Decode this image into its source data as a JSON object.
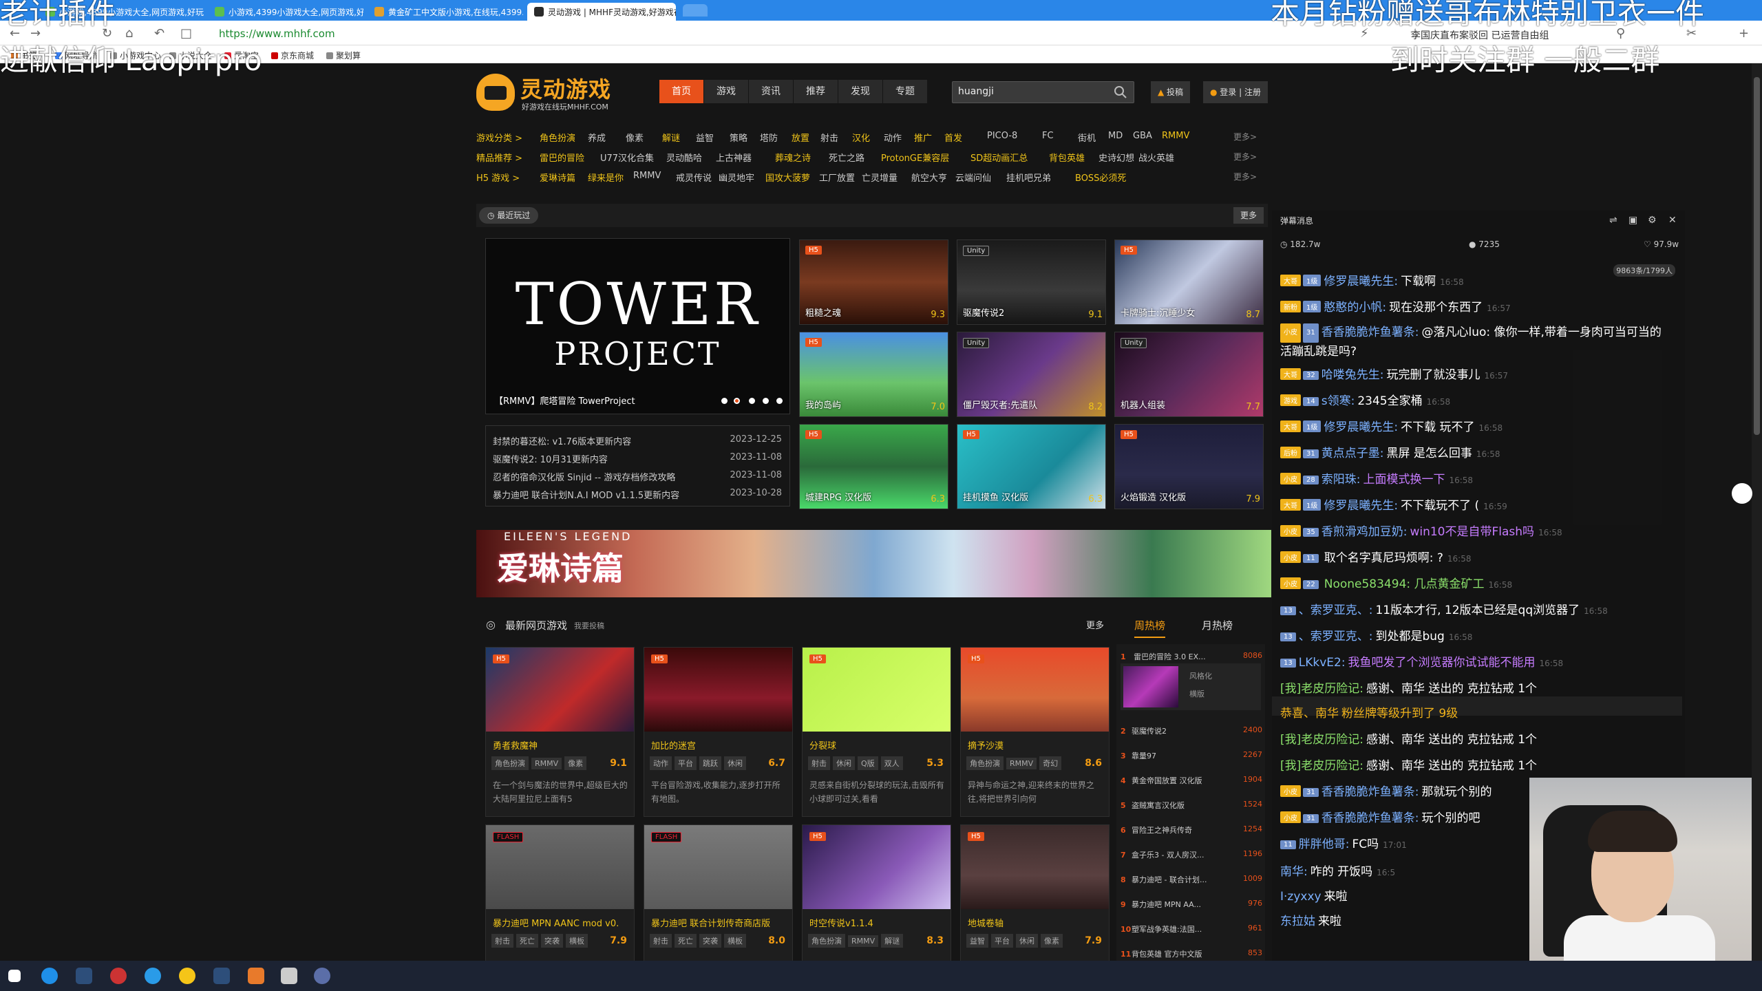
{
  "browser": {
    "tabs": [
      {
        "title": "小游戏,4399小游戏大全,网页游戏,好玩的..."
      },
      {
        "title": "小游戏,4399小游戏大全,网页游戏,好玩的..."
      },
      {
        "title": "黄金矿工中文版小游戏,在线玩,4399..."
      },
      {
        "title": "灵动游戏 | MHHF灵动游戏,好游戏在..."
      }
    ],
    "url": "https://www.mhhf.com",
    "bookmarks": [
      "书签",
      "网址导航",
      "小游戏中心",
      "小说大全",
      "爱淘宝",
      "京东商城",
      "聚划算"
    ],
    "promo_text": "李国庆直布案驳回 已运营自由组"
  },
  "site": {
    "logo_name": "灵动游戏",
    "logo_sub": "好游戏在线玩MHHF.COM",
    "nav": [
      "首页",
      "游戏",
      "资讯",
      "推荐",
      "发现",
      "专题"
    ],
    "search_value": "huangji",
    "submit_label": "投稿",
    "login_label": "登录 | 注册"
  },
  "categories": [
    {
      "label": "游戏分类 >",
      "items": [
        "角色扮演",
        "养成",
        "像素",
        "解谜",
        "益智",
        "策略",
        "塔防",
        "放置",
        "射击",
        "汉化",
        "动作",
        "推广",
        "首发",
        "PICO-8",
        "FC",
        "街机",
        "MD",
        "GBA",
        "RMMV"
      ],
      "hot": [
        0,
        3,
        7,
        9,
        11,
        12,
        18
      ],
      "more": "更多>"
    },
    {
      "label": "精品推荐 >",
      "items": [
        "雷巴的冒险",
        "U77汉化合集",
        "灵动酷哈",
        "上古神器",
        "葬魂之诗",
        "死亡之路",
        "ProtonGE兼容层",
        "SD超动画汇总",
        "背包英雄",
        "史诗幻想",
        "战火英雄"
      ],
      "hot": [
        0,
        4,
        6,
        7,
        8
      ],
      "more": "更多>"
    },
    {
      "label": "H5 游戏 >",
      "items": [
        "爱琳诗篇",
        "绿来是你",
        "RMMV",
        "戒灵传说",
        "幽灵地牢",
        "国攻大菠萝",
        "工厂放置",
        "亡灵增量",
        "航空大亨",
        "云端问仙",
        "挂机吧兄弟",
        "BOSS必须死"
      ],
      "hot": [
        0,
        1,
        5,
        11
      ],
      "more": "更多>"
    }
  ],
  "recent": {
    "label": "最近玩过",
    "more": "更多",
    "slider_title_1": "TOWER",
    "slider_title_2": "PROJECT",
    "slider_caption": "【RMMV】爬塔冒险 TowerProject",
    "news": [
      {
        "title": "封禁的暮还松: v1.76版本更新内容",
        "date": "2023-12-25"
      },
      {
        "title": "驱魔传说2: 10月31更新内容",
        "date": "2023-11-08"
      },
      {
        "title": "忍者的宿命汉化版 Sinjid -- 游戏存档修改攻略",
        "date": "2023-11-08"
      },
      {
        "title": "暴力迪吧 联合计划N.A.I MOD v1.1.5更新内容",
        "date": "2023-10-28"
      }
    ],
    "games": [
      {
        "name": "粗糙之魂",
        "score": "9.3",
        "badge": "H5"
      },
      {
        "name": "驱魔传说2",
        "score": "9.1",
        "badge": "Unity"
      },
      {
        "name": "卡牌骑士:沉睡少女",
        "score": "8.7",
        "badge": "H5"
      },
      {
        "name": "我的岛屿",
        "score": "7.0",
        "badge": "H5"
      },
      {
        "name": "僵尸毁灭者:先遣队",
        "score": "8.2",
        "badge": "Unity"
      },
      {
        "name": "机器人组装",
        "score": "7.7",
        "badge": "Unity"
      },
      {
        "name": "城建RPG 汉化版",
        "score": "6.3",
        "badge": "H5"
      },
      {
        "name": "挂机摸鱼 汉化版",
        "score": "6.3",
        "badge": "H5"
      },
      {
        "name": "火焰锻造 汉化版",
        "score": "7.9",
        "badge": "H5"
      }
    ]
  },
  "banner": {
    "title": "爱琳诗篇",
    "subtitle": "EILEEN'S LEGEND"
  },
  "latest": {
    "title": "最新网页游戏",
    "sub": "我要投稿",
    "more": "更多",
    "tabs": [
      "周热榜",
      "月热榜"
    ],
    "cards": [
      {
        "name": "勇者救魔神",
        "tags": [
          "角色扮演",
          "RMMV",
          "像素"
        ],
        "score": "9.1",
        "desc": "在一个剑与魔法的世界中,超级巨大的大陆阿里拉尼上面有5",
        "badge": "H5"
      },
      {
        "name": "加比的迷宫",
        "tags": [
          "动作",
          "平台",
          "跳跃",
          "休闲"
        ],
        "score": "6.7",
        "desc": "平台冒险游戏,收集能力,逐步打开所有地图。",
        "badge": "H5"
      },
      {
        "name": "分裂球",
        "tags": [
          "射击",
          "休闲",
          "Q版",
          "双人"
        ],
        "score": "5.3",
        "desc": "灵感来自街机分裂球的玩法,击毁所有小球即可过关,看看",
        "badge": "H5"
      },
      {
        "name": "摘予沙漠",
        "tags": [
          "角色扮演",
          "RMMV",
          "奇幻"
        ],
        "score": "8.6",
        "desc": "异神与命运之神,迎来终末的世界之往,将把世界引向何",
        "badge": "H5"
      },
      {
        "name": "暴力迪吧 MPN AANC mod v0.",
        "tags": [
          "射击",
          "死亡",
          "突袭",
          "横板"
        ],
        "score": "7.9",
        "desc": "",
        "badge": "FLASH"
      },
      {
        "name": "暴力迪吧 联合计划传奇商店版",
        "tags": [
          "射击",
          "死亡",
          "突袭",
          "横板"
        ],
        "score": "8.0",
        "desc": "",
        "badge": "FLASH"
      },
      {
        "name": "时空传说v1.1.4",
        "tags": [
          "角色扮演",
          "RMMV",
          "解谜"
        ],
        "score": "8.3",
        "desc": "",
        "badge": "H5"
      },
      {
        "name": "地城卷轴",
        "tags": [
          "益智",
          "平台",
          "休闲",
          "像素"
        ],
        "score": "7.9",
        "desc": "",
        "badge": "H5"
      }
    ]
  },
  "ranking": {
    "featured": {
      "rank": "1",
      "name": "雷巴的冒险 3.0 EX...",
      "count": "8086",
      "tags": [
        "风格化",
        "横版"
      ]
    },
    "items": [
      {
        "rank": "2",
        "name": "驱魔传说2",
        "count": "2400"
      },
      {
        "rank": "3",
        "name": "靠量97",
        "count": "2267"
      },
      {
        "rank": "4",
        "name": "黄金帝国放置 汉化版",
        "count": "1904"
      },
      {
        "rank": "5",
        "name": "盗贼寓言汉化版",
        "count": "1524"
      },
      {
        "rank": "6",
        "name": "冒险王之神兵传奇",
        "count": "1254"
      },
      {
        "rank": "7",
        "name": "盒子乐3 - 双人房汉...",
        "count": "1196"
      },
      {
        "rank": "8",
        "name": "暴力迪吧 - 联合计划...",
        "count": "1009"
      },
      {
        "rank": "9",
        "name": "暴力迪吧 MPN AA...",
        "count": "976"
      },
      {
        "rank": "10",
        "name": "塑军战争英雄:法国...",
        "count": "961"
      },
      {
        "rank": "11",
        "name": "背包英雄 官方中文版",
        "count": "853"
      }
    ]
  },
  "chat": {
    "title": "弹幕消息",
    "stats": {
      "heat": "182.7w",
      "viewers": "7235",
      "likes": "97.9w"
    },
    "extra": "9863条/1799人",
    "messages": [
      {
        "badge1": "大哥",
        "badge2": "1级",
        "user": "修罗晨曦先生:",
        "text": "下载啊",
        "time": "16:58",
        "tcolor": "w"
      },
      {
        "badge1": "新粉",
        "badge2": "1级",
        "user": "憨憨的小帆:",
        "text": "现在没那个东西了",
        "time": "16:57",
        "tcolor": "w"
      },
      {
        "badge1": "小皮",
        "badge2": "31",
        "user": "香香脆脆炸鱼薯条:",
        "text": "@落凡心luo: 像你一样,带着一身肉可当可当的活蹦乱跳是吗?",
        "time": "",
        "tcolor": "w"
      },
      {
        "badge1": "大哥",
        "badge2": "32",
        "user": "哈喽兔先生:",
        "text": "玩完删了就没事儿",
        "time": "16:57",
        "tcolor": "w"
      },
      {
        "badge1": "游戏",
        "badge2": "14",
        "user": "s领寒:",
        "text": "2345全家桶",
        "time": "16:58",
        "tcolor": "w"
      },
      {
        "badge1": "大哥",
        "badge2": "1级",
        "user": "修罗晨曦先生:",
        "text": "不下载 玩不了",
        "time": "16:58",
        "tcolor": "w"
      },
      {
        "badge1": "后粉",
        "badge2": "31",
        "user": "黄点点子墨:",
        "text": "黑屏 是怎么回事",
        "time": "16:58",
        "tcolor": "w"
      },
      {
        "badge1": "小皮",
        "badge2": "28",
        "user": "索阳珠:",
        "text": "上面模式换一下",
        "time": "16:58",
        "tcolor": "p"
      },
      {
        "badge1": "大哥",
        "badge2": "1级",
        "user": "修罗晨曦先生:",
        "text": "不下载玩不了 (",
        "time": "16:59",
        "tcolor": "w"
      },
      {
        "badge1": "小皮",
        "badge2": "35",
        "user": "香煎滑鸡加豆奶:",
        "text": "win10不是自带Flash吗",
        "time": "16:58",
        "tcolor": "p"
      },
      {
        "badge1": "小皮",
        "badge2": "11",
        "user": "",
        "text": "取个名字真尼玛烦啊: ?",
        "time": "16:58",
        "tcolor": "w"
      },
      {
        "badge1": "小皮",
        "badge2": "22",
        "user": "",
        "text": "Noone583494: 几点黄金矿工",
        "time": "16:58",
        "tcolor": "g"
      },
      {
        "badge1": "",
        "badge2": "13",
        "user": "、索罗亚克、:",
        "text": "11版本才行, 12版本已经是qq浏览器了",
        "time": "16:58",
        "tcolor": "w"
      },
      {
        "badge1": "",
        "badge2": "13",
        "user": "、索罗亚克、:",
        "text": "到处都是bug",
        "time": "16:58",
        "tcolor": "w"
      },
      {
        "badge1": "",
        "badge2": "13",
        "user": "LKkvE2:",
        "text": "我鱼吧发了个浏览器你试试能不能用",
        "time": "16:58",
        "tcolor": "p"
      },
      {
        "badge1": "",
        "badge2": "",
        "user": "[我]老皮历险记:",
        "text": "感谢、南华 送出的 克拉钻戒 1个",
        "time": "",
        "tcolor": "w",
        "ucolor": "g"
      },
      {
        "badge1": "",
        "badge2": "",
        "user": "恭喜、南华",
        "text": "粉丝牌等级升到了 9级",
        "time": "",
        "tcolor": "o",
        "ucolor": "o"
      },
      {
        "badge1": "",
        "badge2": "",
        "user": "[我]老皮历险记:",
        "text": "感谢、南华 送出的 克拉钻戒 1个",
        "time": "",
        "tcolor": "w",
        "ucolor": "g"
      },
      {
        "badge1": "",
        "badge2": "",
        "user": "[我]老皮历险记:",
        "text": "感谢、南华 送出的 克拉钻戒 1个",
        "time": "",
        "tcolor": "w",
        "ucolor": "g"
      },
      {
        "badge1": "小皮",
        "badge2": "31",
        "user": "香香脆脆炸鱼薯条:",
        "text": "那就玩个别的",
        "time": "",
        "tcolor": "w"
      },
      {
        "badge1": "小皮",
        "badge2": "31",
        "user": "香香脆脆炸鱼薯条:",
        "text": "玩个别的吧",
        "time": "",
        "tcolor": "w"
      },
      {
        "badge1": "",
        "badge2": "11",
        "user": "胖胖他哥:",
        "text": "FC吗",
        "time": "17:01",
        "tcolor": "w"
      },
      {
        "badge1": "",
        "badge2": "",
        "user": "南华:",
        "text": "咋的 开饭吗",
        "time": "16:5",
        "tcolor": "w"
      },
      {
        "badge1": "",
        "badge2": "",
        "user": "I·zyxxy",
        "text": "来啦",
        "time": "",
        "tcolor": "w"
      },
      {
        "badge1": "",
        "badge2": "",
        "user": "东拉姑",
        "text": "来啦",
        "time": "",
        "tcolor": "w"
      }
    ]
  },
  "stream_overlay": {
    "top_left": "老计插件",
    "left_line2": "进献信仰 Laopirpro",
    "top_right": "本月钻粉赠送哥布林特别卫衣一件",
    "right_line2": "到时关注群 一般二群"
  },
  "colors": {
    "accent": "#e8511b",
    "gold": "#f0c419",
    "chat_user": "#7cb1ff"
  }
}
